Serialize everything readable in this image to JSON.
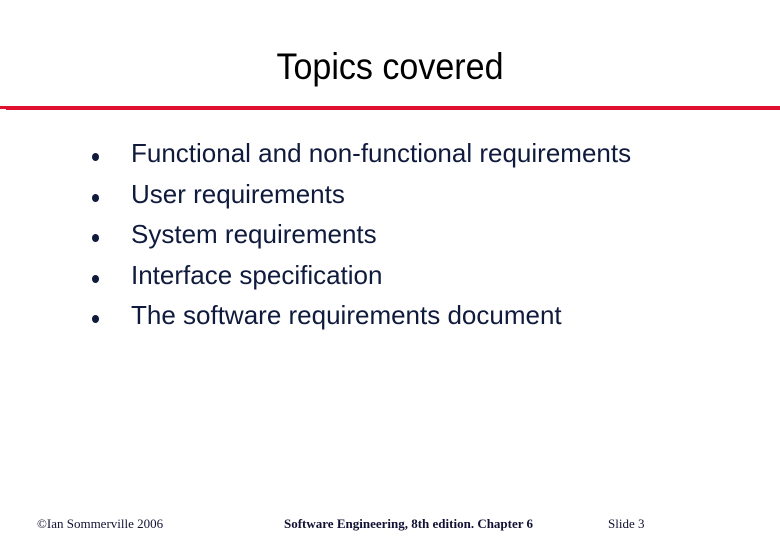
{
  "slide": {
    "title": "Topics covered",
    "accent_color": "#e0102f",
    "bullets": [
      "Functional and non-functional requirements",
      "User requirements",
      "System requirements",
      "Interface specification",
      "The software requirements document"
    ]
  },
  "footer": {
    "copyright": "©Ian Sommerville 2006",
    "book": "Software Engineering, 8th edition. Chapter 6",
    "slide_number": "Slide  3"
  }
}
